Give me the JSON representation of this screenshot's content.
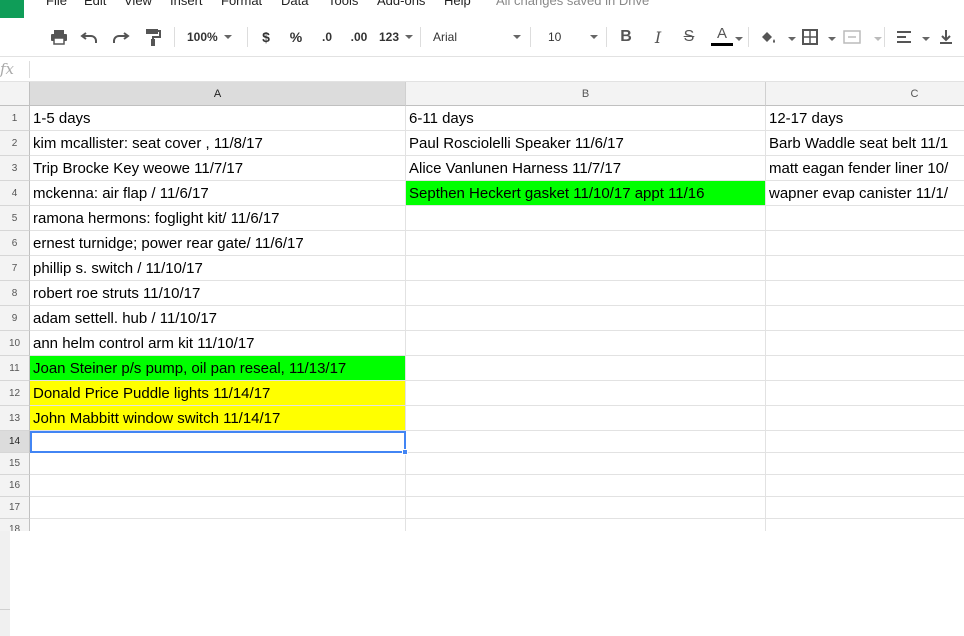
{
  "menu": {
    "items": [
      "File",
      "Edit",
      "View",
      "Insert",
      "Format",
      "Data",
      "Tools",
      "Add-ons",
      "Help"
    ],
    "save_status": "All changes saved in Drive"
  },
  "toolbar": {
    "zoom": "100%",
    "currency": "$",
    "percent": "%",
    "decrease_decimals": ".0",
    "increase_decimals": ".00",
    "more_formats": "123",
    "font": "Arial",
    "font_size": "10",
    "text_color_letter": "A"
  },
  "formula_bar": {
    "label": "fx",
    "value": ""
  },
  "columns": [
    "A",
    "B",
    "C"
  ],
  "rows": [
    {
      "num": "1",
      "A": "1-5 days",
      "B": "6-11 days",
      "C": "12-17 days"
    },
    {
      "num": "2",
      "A": "kim mcallister: seat cover , 11/8/17",
      "B": "Paul Rosciolelli Speaker 11/6/17",
      "C": "Barb Waddle seat belt 11/1"
    },
    {
      "num": "3",
      "A": "Trip Brocke Key weowe 11/7/17",
      "B": "Alice Vanlunen  Harness 11/7/17",
      "C": "matt eagan fender liner 10/"
    },
    {
      "num": "4",
      "A": "mckenna: air flap / 11/6/17",
      "B": "Septhen Heckert gasket   11/10/17 appt 11/16",
      "C": "wapner evap canister 11/1/"
    },
    {
      "num": "5",
      "A": "ramona hermons: foglight kit/ 11/6/17",
      "B": "",
      "C": ""
    },
    {
      "num": "6",
      "A": "ernest turnidge; power rear gate/ 11/6/17",
      "B": "",
      "C": ""
    },
    {
      "num": "7",
      "A": "phillip s. switch / 11/10/17",
      "B": "",
      "C": ""
    },
    {
      "num": "8",
      "A": "robert roe  struts 11/10/17",
      "B": "",
      "C": ""
    },
    {
      "num": "9",
      "A": "adam settell. hub / 11/10/17",
      "B": "",
      "C": ""
    },
    {
      "num": "10",
      "A": "ann helm control arm kit   11/10/17",
      "B": "",
      "C": ""
    },
    {
      "num": "11",
      "A": "Joan Steiner p/s pump, oil pan reseal, 11/13/17",
      "B": "",
      "C": ""
    },
    {
      "num": "12",
      "A": "Donald Price Puddle lights 11/14/17",
      "B": "",
      "C": ""
    },
    {
      "num": "13",
      "A": "John Mabbitt window switch 11/14/17",
      "B": "",
      "C": ""
    },
    {
      "num": "14",
      "A": "",
      "B": "",
      "C": ""
    },
    {
      "num": "15",
      "A": "",
      "B": "",
      "C": ""
    },
    {
      "num": "16",
      "A": "",
      "B": "",
      "C": ""
    },
    {
      "num": "17",
      "A": "",
      "B": "",
      "C": ""
    },
    {
      "num": "18",
      "A": "",
      "B": "",
      "C": ""
    }
  ],
  "highlights": {
    "green": "#00ff00",
    "yellow": "#ffff00",
    "selection": "#4285f4",
    "brand": "#0f9d58"
  },
  "selected_cell": "A14"
}
